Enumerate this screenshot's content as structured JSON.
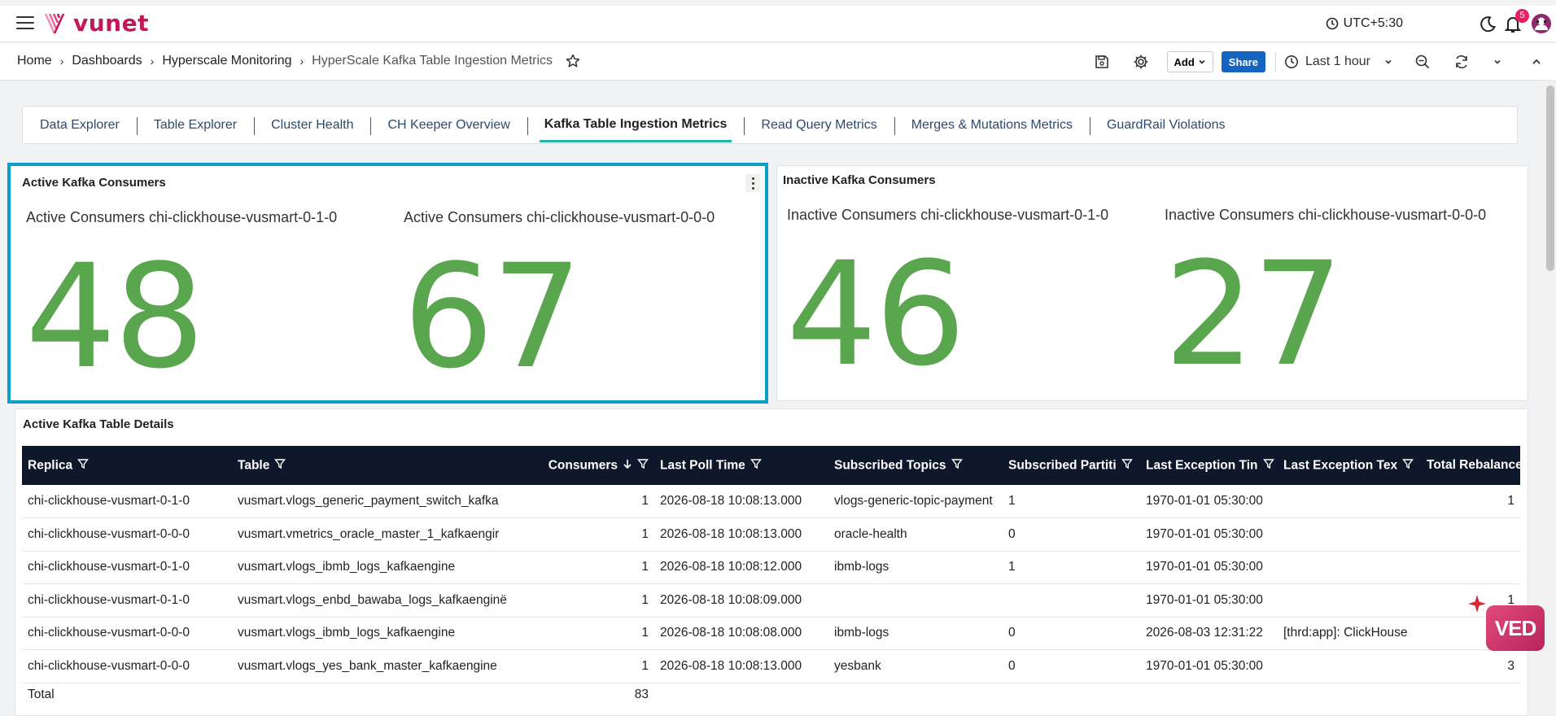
{
  "header": {
    "brand": "vunet",
    "timezone": "UTC+5:30",
    "notification_count": "5"
  },
  "breadcrumb": [
    "Home",
    "Dashboards",
    "Hyperscale Monitoring",
    "HyperScale Kafka Table Ingestion Metrics"
  ],
  "toolbar": {
    "add_label": "Add",
    "share_label": "Share",
    "time_range": "Last 1 hour"
  },
  "tabs": [
    "Data Explorer",
    "Table Explorer",
    "Cluster Health",
    "CH Keeper Overview",
    "Kafka Table Ingestion Metrics",
    "Read Query Metrics",
    "Merges & Mutations Metrics",
    "GuardRail Violations"
  ],
  "active_tab": "Kafka Table Ingestion Metrics",
  "active_panel": {
    "title": "Active Kafka Consumers",
    "stats": [
      {
        "label": "Active Consumers chi-clickhouse-vusmart-0-1-0",
        "value": "48"
      },
      {
        "label": "Active Consumers chi-clickhouse-vusmart-0-0-0",
        "value": "67"
      }
    ]
  },
  "inactive_panel": {
    "title": "Inactive Kafka Consumers",
    "stats": [
      {
        "label": "Inactive Consumers chi-clickhouse-vusmart-0-1-0",
        "value": "46"
      },
      {
        "label": "Inactive Consumers chi-clickhouse-vusmart-0-0-0",
        "value": "27"
      }
    ]
  },
  "table_panel": {
    "title": "Active Kafka Table Details",
    "columns": [
      "Replica",
      "Table",
      "Consumers",
      "Last Poll Time",
      "Subscribed Topics",
      "Subscribed Partiti",
      "Last Exception Tin",
      "Last Exception Tex",
      "Total Rebalance"
    ],
    "rows": [
      [
        "chi-clickhouse-vusmart-0-1-0",
        "vusmart.vlogs_generic_payment_switch_kafka",
        "1",
        "2026-08-18 10:08:13.000",
        "vlogs-generic-topic-payment",
        "1",
        "1970-01-01 05:30:00",
        "",
        "1"
      ],
      [
        "chi-clickhouse-vusmart-0-0-0",
        "vusmart.vmetrics_oracle_master_1_kafkaengir",
        "1",
        "2026-08-18 10:08:13.000",
        "oracle-health",
        "0",
        "1970-01-01 05:30:00",
        "",
        ""
      ],
      [
        "chi-clickhouse-vusmart-0-1-0",
        "vusmart.vlogs_ibmb_logs_kafkaengine",
        "1",
        "2026-08-18 10:08:12.000",
        "ibmb-logs",
        "1",
        "1970-01-01 05:30:00",
        "",
        ""
      ],
      [
        "chi-clickhouse-vusmart-0-1-0",
        "vusmart.vlogs_enbd_bawaba_logs_kafkaenginё",
        "1",
        "2026-08-18 10:08:09.000",
        "",
        "",
        "1970-01-01 05:30:00",
        "",
        "1"
      ],
      [
        "chi-clickhouse-vusmart-0-0-0",
        "vusmart.vlogs_ibmb_logs_kafkaengine",
        "1",
        "2026-08-18 10:08:08.000",
        "ibmb-logs",
        "0",
        "2026-08-03 12:31:22",
        "[thrd:app]: ClickHouse",
        ""
      ],
      [
        "chi-clickhouse-vusmart-0-0-0",
        "vusmart.vlogs_yes_bank_master_kafkaengine",
        "1",
        "2026-08-18 10:08:13.000",
        "yesbank",
        "0",
        "1970-01-01 05:30:00",
        "",
        "3"
      ]
    ],
    "total_label": "Total",
    "total_consumers": "83"
  },
  "assistant_badge": "VED",
  "colors": {
    "stat_green": "#5aa64f",
    "accent_teal": "#26b5a6",
    "selection": "#0aa0c6",
    "brand": "#c2185b",
    "share": "#1565c0",
    "table_header": "#0f172a"
  }
}
